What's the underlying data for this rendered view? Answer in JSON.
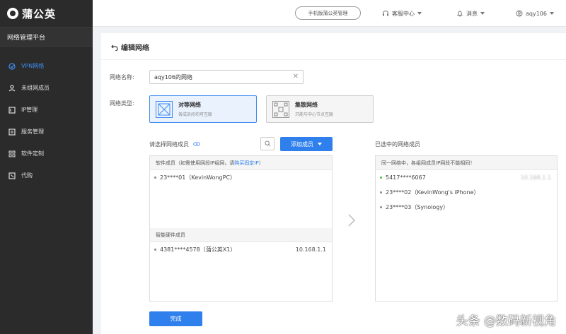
{
  "sidebar": {
    "brand": "蒲公英",
    "platform": "网络管理平台",
    "items": [
      {
        "label": "VPN网络",
        "active": true,
        "icon": "vpn-icon"
      },
      {
        "label": "未组网成员",
        "active": false,
        "icon": "user-icon"
      },
      {
        "label": "IP管理",
        "active": false,
        "icon": "ip-icon"
      },
      {
        "label": "服务管理",
        "active": false,
        "icon": "service-icon"
      },
      {
        "label": "软件定制",
        "active": false,
        "icon": "grid-icon"
      },
      {
        "label": "代购",
        "active": false,
        "icon": "cart-icon"
      }
    ]
  },
  "header": {
    "mobile_btn": "手机版蒲公英管理",
    "support": "客服中心",
    "messages": "消息",
    "user": "aqy106"
  },
  "page": {
    "title": "编辑网络",
    "name_label": "网络名称:",
    "name_value": "aqy106的网络",
    "type_label": "网络类型:",
    "types": [
      {
        "title": "对等网络",
        "sub": "各成员间均可互联",
        "selected": true
      },
      {
        "title": "集散网络",
        "sub": "只能与中心节点互联",
        "selected": false
      }
    ],
    "select_label": "请选择网络成员",
    "add_btn": "添加成员",
    "selected_label": "已选中的网络成员",
    "done_btn": "完成"
  },
  "left_panel": {
    "software_head": "软件成员（如需使用网段IP组网，请",
    "software_link": "购买固定IP",
    "software_tail": "）",
    "software_rows": [
      {
        "name": "23****01（KevinWongPC）"
      }
    ],
    "hardware_head": "智能硬件成员",
    "hardware_rows": [
      {
        "name": "4381****4578（蒲公英X1）",
        "ip": "10.168.1.1"
      }
    ]
  },
  "right_panel": {
    "head": "同一网络中，各组网成员IP网段不能相同！",
    "rows": [
      {
        "name": "5417****6067",
        "ip": "10.168.1.1",
        "dot": "green"
      },
      {
        "name": "23****02（KevinWong's iPhone）",
        "ip": "",
        "dot": "gray"
      },
      {
        "name": "23****03（Synology）",
        "ip": "",
        "dot": "gray"
      }
    ]
  },
  "watermark": "头条 @数码新视角",
  "colors": {
    "accent": "#2f80ed",
    "sidebar": "#2b2b2b",
    "active": "#3f8bf2"
  }
}
